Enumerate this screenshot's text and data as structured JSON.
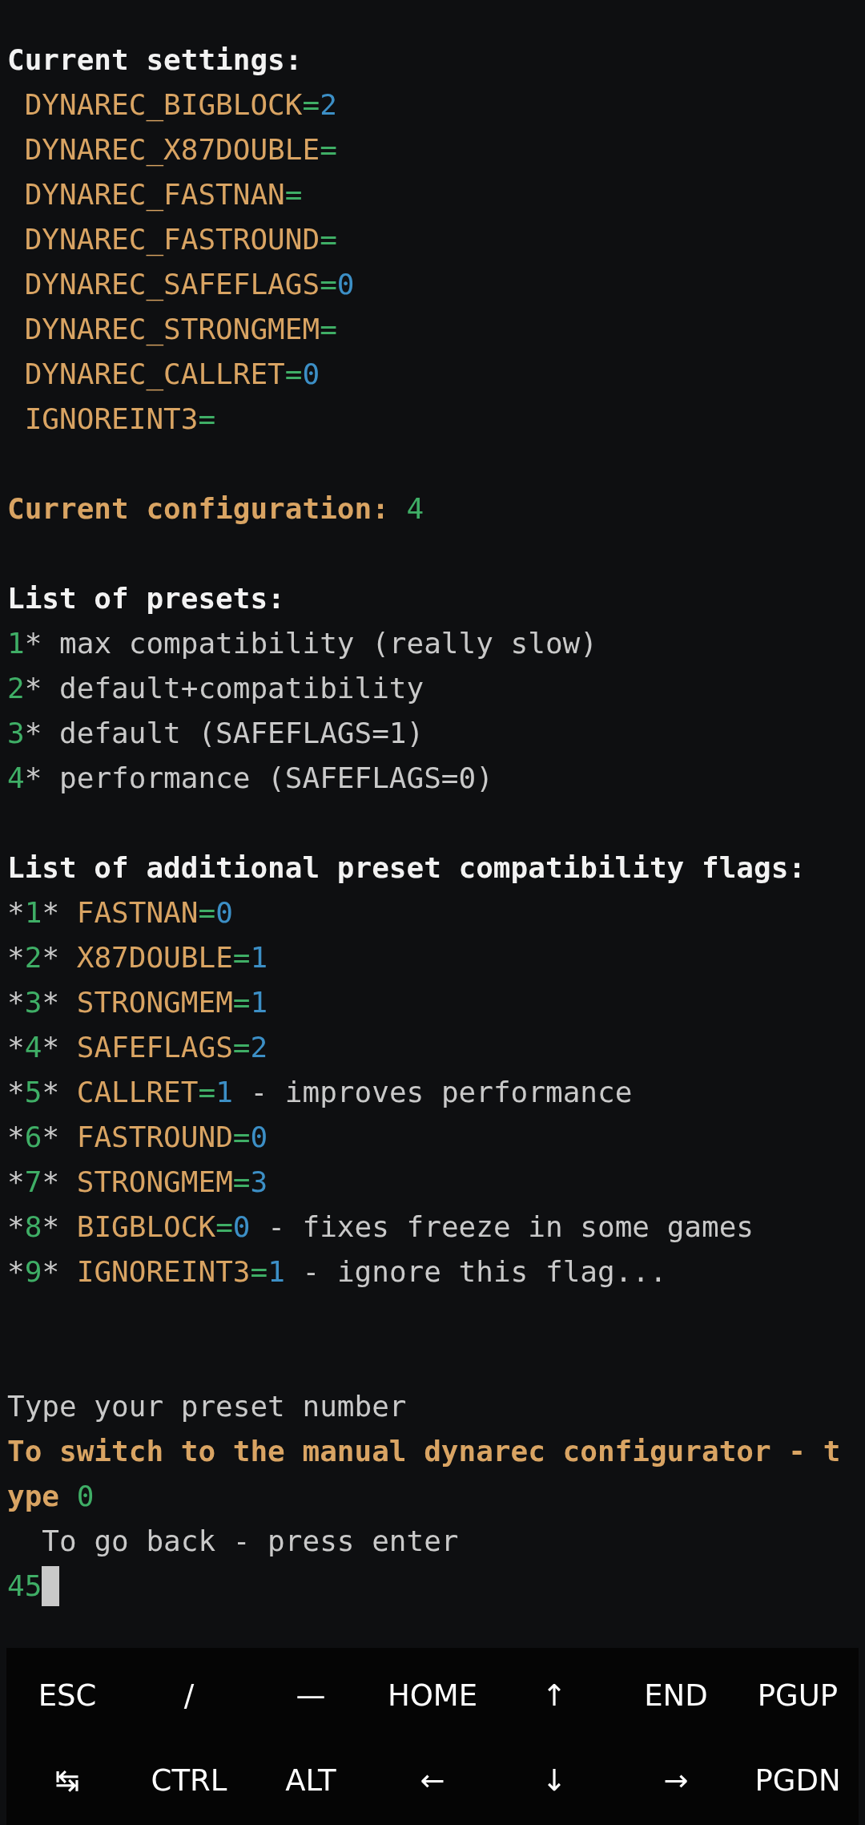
{
  "terminal": {
    "lines": [
      {
        "kind": "text",
        "segments": [
          {
            "text": "Current settings:",
            "kind": "heading"
          }
        ]
      },
      {
        "kind": "text",
        "segments": [
          {
            "text": " DYNAREC_BIGBLOCK",
            "kind": "key"
          },
          {
            "text": "=",
            "kind": "op"
          },
          {
            "text": "2",
            "kind": "value"
          }
        ]
      },
      {
        "kind": "text",
        "segments": [
          {
            "text": " DYNAREC_X87DOUBLE",
            "kind": "key"
          },
          {
            "text": "=",
            "kind": "op"
          }
        ]
      },
      {
        "kind": "text",
        "segments": [
          {
            "text": " DYNAREC_FASTNAN",
            "kind": "key"
          },
          {
            "text": "=",
            "kind": "op"
          }
        ]
      },
      {
        "kind": "text",
        "segments": [
          {
            "text": " DYNAREC_FASTROUND",
            "kind": "key"
          },
          {
            "text": "=",
            "kind": "op"
          }
        ]
      },
      {
        "kind": "text",
        "segments": [
          {
            "text": " DYNAREC_SAFEFLAGS",
            "kind": "key"
          },
          {
            "text": "=",
            "kind": "op"
          },
          {
            "text": "0",
            "kind": "value"
          }
        ]
      },
      {
        "kind": "text",
        "segments": [
          {
            "text": " DYNAREC_STRONGMEM",
            "kind": "key"
          },
          {
            "text": "=",
            "kind": "op"
          }
        ]
      },
      {
        "kind": "text",
        "segments": [
          {
            "text": " DYNAREC_CALLRET",
            "kind": "key"
          },
          {
            "text": "=",
            "kind": "op"
          },
          {
            "text": "0",
            "kind": "value"
          }
        ]
      },
      {
        "kind": "text",
        "segments": [
          {
            "text": " IGNOREINT3",
            "kind": "key"
          },
          {
            "text": "=",
            "kind": "op"
          }
        ]
      },
      {
        "kind": "blank"
      },
      {
        "kind": "text",
        "segments": [
          {
            "text": "Current configuration: ",
            "kind": "notice"
          },
          {
            "text": "4",
            "kind": "number"
          }
        ]
      },
      {
        "kind": "blank"
      },
      {
        "kind": "text",
        "segments": [
          {
            "text": "List of presets:",
            "kind": "heading"
          }
        ]
      },
      {
        "kind": "text",
        "segments": [
          {
            "text": "1",
            "kind": "number"
          },
          {
            "text": "* max compatibility (really slow)",
            "kind": "plain"
          }
        ]
      },
      {
        "kind": "text",
        "segments": [
          {
            "text": "2",
            "kind": "number"
          },
          {
            "text": "* default+compatibility",
            "kind": "plain"
          }
        ]
      },
      {
        "kind": "text",
        "segments": [
          {
            "text": "3",
            "kind": "number"
          },
          {
            "text": "* default (SAFEFLAGS=1)",
            "kind": "plain"
          }
        ]
      },
      {
        "kind": "text",
        "segments": [
          {
            "text": "4",
            "kind": "number"
          },
          {
            "text": "* performance (SAFEFLAGS=0)",
            "kind": "plain"
          }
        ]
      },
      {
        "kind": "blank"
      },
      {
        "kind": "text",
        "segments": [
          {
            "text": "List of additional preset compatibility flags:",
            "kind": "heading"
          }
        ]
      },
      {
        "kind": "text",
        "segments": [
          {
            "text": "*",
            "kind": "plain"
          },
          {
            "text": "1",
            "kind": "number"
          },
          {
            "text": "* ",
            "kind": "plain"
          },
          {
            "text": "FASTNAN",
            "kind": "key"
          },
          {
            "text": "=",
            "kind": "op"
          },
          {
            "text": "0",
            "kind": "value"
          }
        ]
      },
      {
        "kind": "text",
        "segments": [
          {
            "text": "*",
            "kind": "plain"
          },
          {
            "text": "2",
            "kind": "number"
          },
          {
            "text": "* ",
            "kind": "plain"
          },
          {
            "text": "X87DOUBLE",
            "kind": "key"
          },
          {
            "text": "=",
            "kind": "op"
          },
          {
            "text": "1",
            "kind": "value"
          }
        ]
      },
      {
        "kind": "text",
        "segments": [
          {
            "text": "*",
            "kind": "plain"
          },
          {
            "text": "3",
            "kind": "number"
          },
          {
            "text": "* ",
            "kind": "plain"
          },
          {
            "text": "STRONGMEM",
            "kind": "key"
          },
          {
            "text": "=",
            "kind": "op"
          },
          {
            "text": "1",
            "kind": "value"
          }
        ]
      },
      {
        "kind": "text",
        "segments": [
          {
            "text": "*",
            "kind": "plain"
          },
          {
            "text": "4",
            "kind": "number"
          },
          {
            "text": "* ",
            "kind": "plain"
          },
          {
            "text": "SAFEFLAGS",
            "kind": "key"
          },
          {
            "text": "=",
            "kind": "op"
          },
          {
            "text": "2",
            "kind": "value"
          }
        ]
      },
      {
        "kind": "text",
        "segments": [
          {
            "text": "*",
            "kind": "plain"
          },
          {
            "text": "5",
            "kind": "number"
          },
          {
            "text": "* ",
            "kind": "plain"
          },
          {
            "text": "CALLRET",
            "kind": "key"
          },
          {
            "text": "=",
            "kind": "op"
          },
          {
            "text": "1",
            "kind": "value"
          },
          {
            "text": " - improves performance",
            "kind": "plain"
          }
        ]
      },
      {
        "kind": "text",
        "segments": [
          {
            "text": "*",
            "kind": "plain"
          },
          {
            "text": "6",
            "kind": "number"
          },
          {
            "text": "* ",
            "kind": "plain"
          },
          {
            "text": "FASTROUND",
            "kind": "key"
          },
          {
            "text": "=",
            "kind": "op"
          },
          {
            "text": "0",
            "kind": "value"
          }
        ]
      },
      {
        "kind": "text",
        "segments": [
          {
            "text": "*",
            "kind": "plain"
          },
          {
            "text": "7",
            "kind": "number"
          },
          {
            "text": "* ",
            "kind": "plain"
          },
          {
            "text": "STRONGMEM",
            "kind": "key"
          },
          {
            "text": "=",
            "kind": "op"
          },
          {
            "text": "3",
            "kind": "value"
          }
        ]
      },
      {
        "kind": "text",
        "segments": [
          {
            "text": "*",
            "kind": "plain"
          },
          {
            "text": "8",
            "kind": "number"
          },
          {
            "text": "* ",
            "kind": "plain"
          },
          {
            "text": "BIGBLOCK",
            "kind": "key"
          },
          {
            "text": "=",
            "kind": "op"
          },
          {
            "text": "0",
            "kind": "value"
          },
          {
            "text": " - fixes freeze in some games",
            "kind": "plain"
          }
        ]
      },
      {
        "kind": "text",
        "segments": [
          {
            "text": "*",
            "kind": "plain"
          },
          {
            "text": "9",
            "kind": "number"
          },
          {
            "text": "* ",
            "kind": "plain"
          },
          {
            "text": "IGNOREINT3",
            "kind": "key"
          },
          {
            "text": "=",
            "kind": "op"
          },
          {
            "text": "1",
            "kind": "value"
          },
          {
            "text": " - ignore this flag...",
            "kind": "plain"
          }
        ]
      },
      {
        "kind": "blank"
      },
      {
        "kind": "blank"
      },
      {
        "kind": "text",
        "segments": [
          {
            "text": "Type your preset number",
            "kind": "plain"
          }
        ]
      },
      {
        "kind": "text",
        "segments": [
          {
            "text": "To switch to the manual dynarec configurator - type ",
            "kind": "notice"
          },
          {
            "text": "0",
            "kind": "number"
          }
        ]
      },
      {
        "kind": "text",
        "segments": [
          {
            "text": "  To go back - press enter",
            "kind": "plain"
          }
        ]
      },
      {
        "kind": "input",
        "segments": [
          {
            "text": "45",
            "kind": "number"
          }
        ]
      }
    ]
  },
  "extra_keys": {
    "rows": [
      [
        "ESC",
        "/",
        "—",
        "HOME",
        "↑",
        "END",
        "PGUP"
      ],
      [
        "↹",
        "CTRL",
        "ALT",
        "←",
        "↓",
        "→",
        "PGDN"
      ]
    ]
  }
}
